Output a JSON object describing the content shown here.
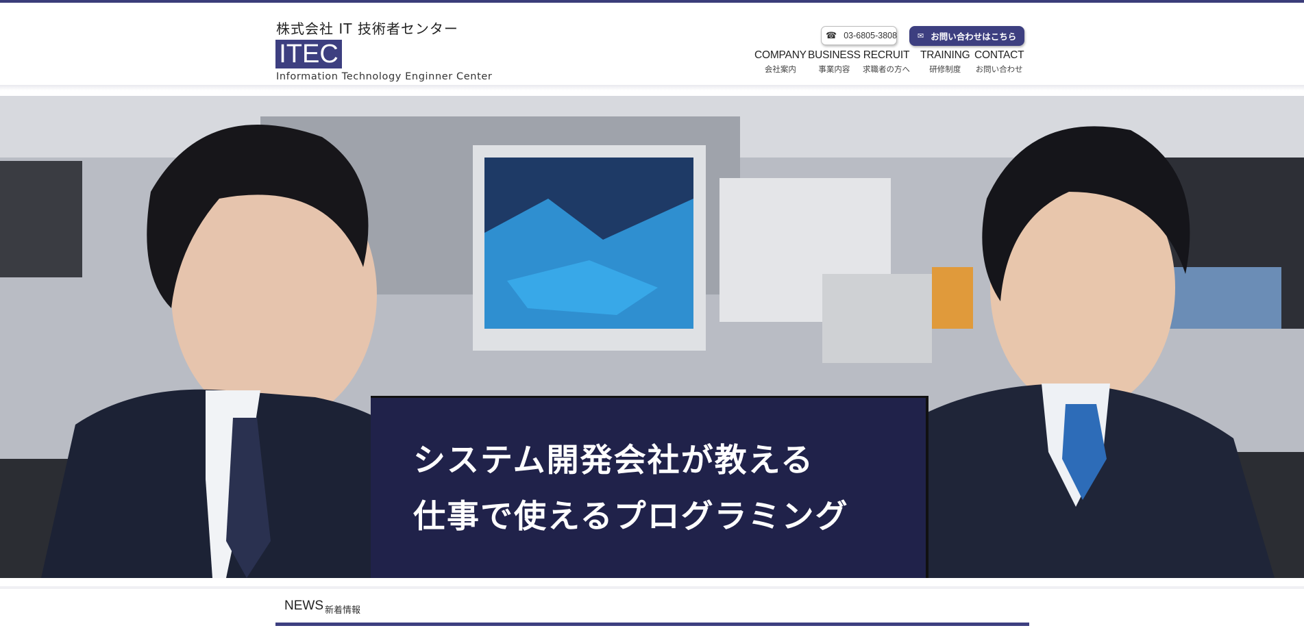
{
  "header": {
    "company_name": "株式会社 IT 技術者センター",
    "logo_text": "ITEC",
    "tagline": "Information Technology Enginner Center",
    "phone": {
      "icon": "phone-icon",
      "number": "03-6805-3808"
    },
    "contact_button": {
      "icon": "mail-icon",
      "label": "お問い合わせはこちら"
    },
    "nav": [
      {
        "en": "COMPANY",
        "jp": "会社案内"
      },
      {
        "en": "BUSINESS",
        "jp": "事業内容"
      },
      {
        "en": "RECRUIT",
        "jp": "求職者の方へ"
      },
      {
        "en": "TRAINING",
        "jp": "研修制度"
      },
      {
        "en": "CONTACT",
        "jp": "お問い合わせ"
      }
    ]
  },
  "hero": {
    "line1": "システム開発会社が教える",
    "line2": "仕事で使えるプログラミング"
  },
  "news": {
    "title": "NEWS",
    "subtitle": "新着情報"
  },
  "colors": {
    "brand": "#3d3f80",
    "hero_box": "#20224a",
    "top_bar": "#3b3d7a"
  }
}
